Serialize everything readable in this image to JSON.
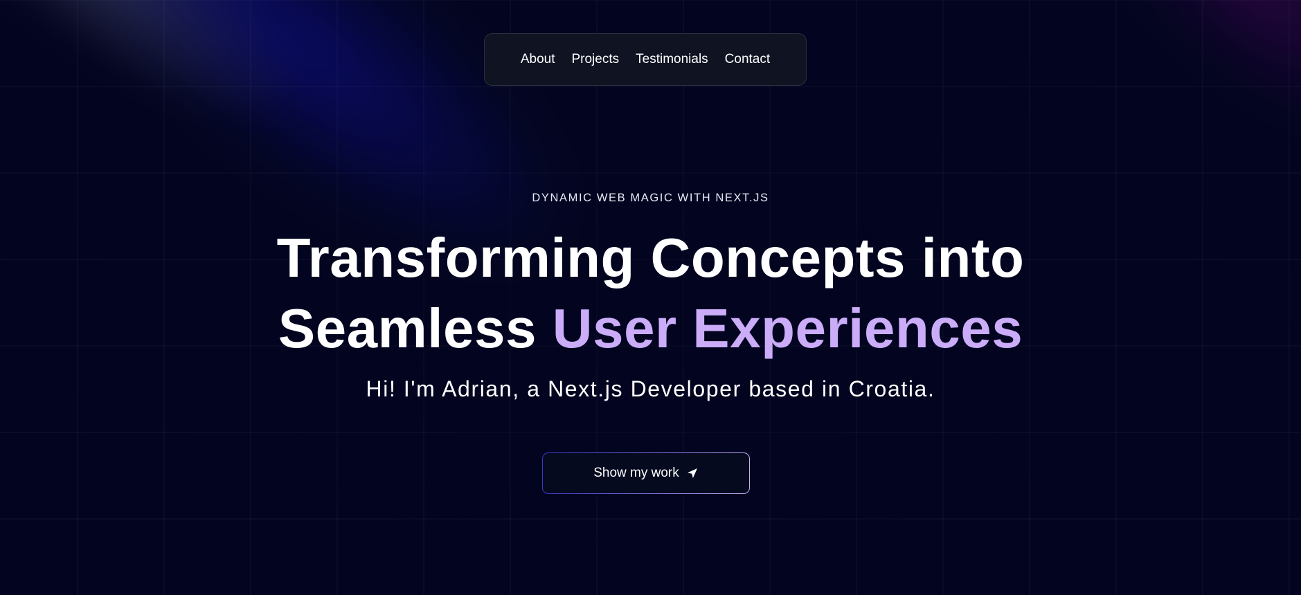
{
  "nav": {
    "items": [
      {
        "label": "About"
      },
      {
        "label": "Projects"
      },
      {
        "label": "Testimonials"
      },
      {
        "label": "Contact"
      }
    ]
  },
  "hero": {
    "eyebrow": "DYNAMIC WEB MAGIC WITH NEXT.JS",
    "headline_line1": "Transforming Concepts into",
    "headline_line2_plain": "Seamless ",
    "headline_line2_accent": "User Experiences",
    "subline": "Hi! I'm Adrian, a Next.js Developer based in Croatia.",
    "cta_label": "Show my work",
    "cta_icon": "send-arrow-icon"
  },
  "colors": {
    "background": "#030520",
    "accent_purple": "#cbacf9",
    "nav_background": "#0f1322",
    "button_border_start": "#3a37c9",
    "button_border_end": "#c3b0f7"
  }
}
